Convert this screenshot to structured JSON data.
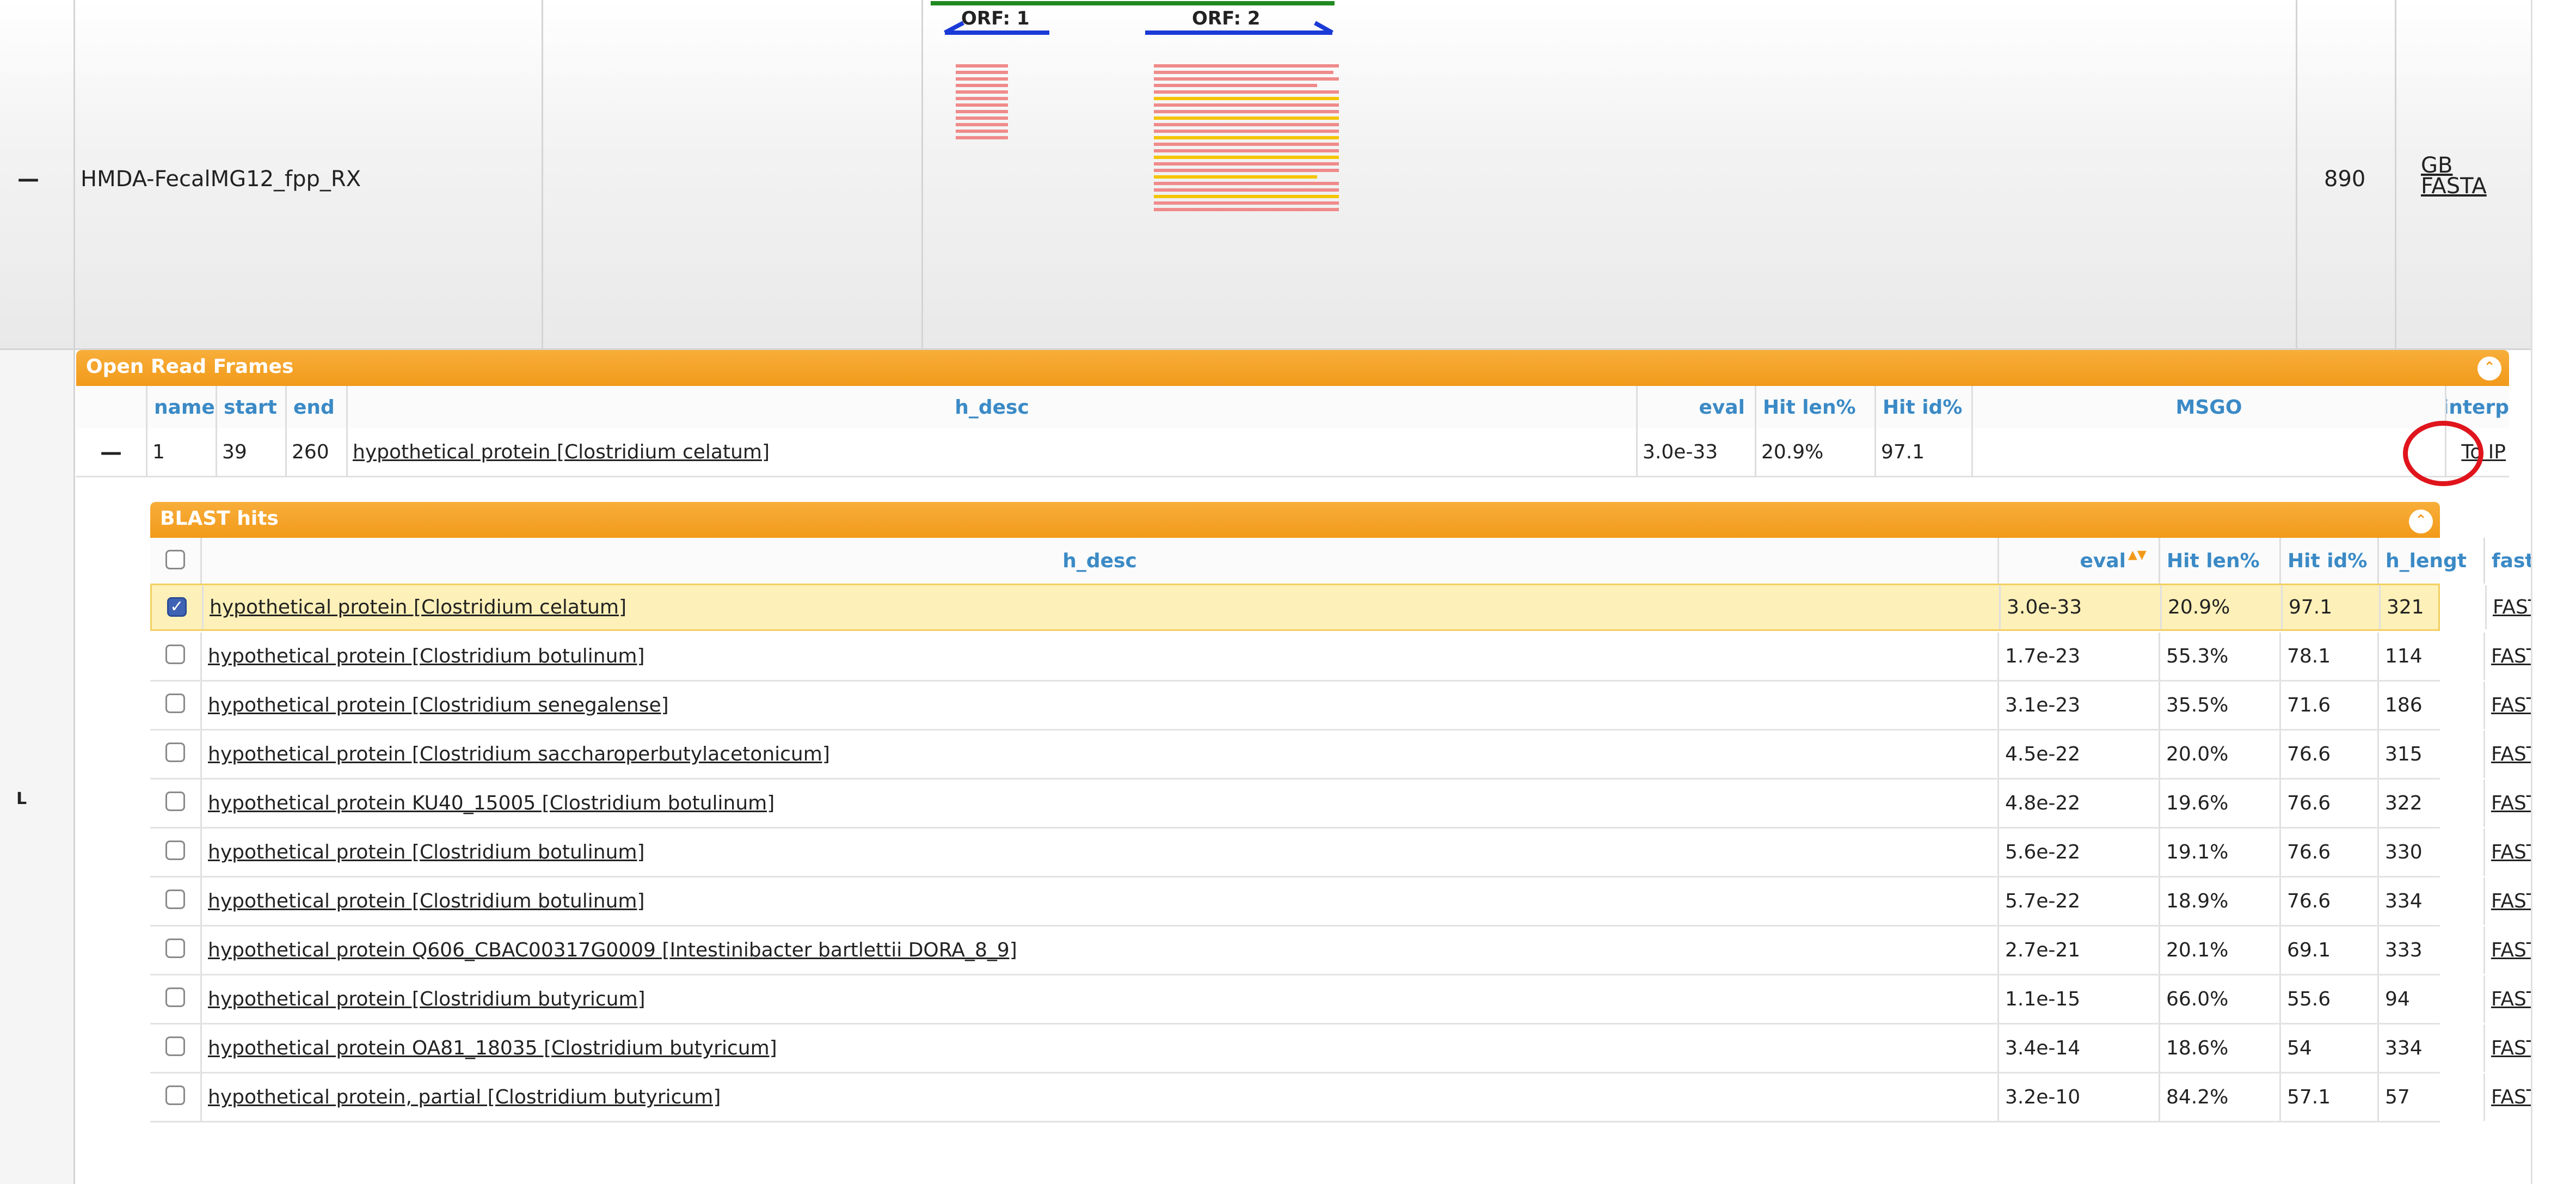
{
  "main_row": {
    "toggle": "—",
    "name": "HMDA-FecalMG12_fpp_RX",
    "length": "890",
    "links": [
      "GB",
      "FASTA"
    ]
  },
  "orf_track": {
    "labels": [
      "ORF: 1",
      "ORF: 2"
    ]
  },
  "left_markers": [
    "L",
    "L"
  ],
  "orf_panel": {
    "title": "Open Read Frames",
    "columns": [
      "name",
      "start",
      "end",
      "h_desc",
      "eval",
      "Hit len%",
      "Hit id%",
      "MSGO",
      "interp"
    ],
    "row": {
      "toggle": "—",
      "name": "1",
      "start": "39",
      "end": "260",
      "h_desc": "hypothetical protein [Clostridium celatum]",
      "eval": "3.0e-33",
      "hit_len": "20.9%",
      "hit_id": "97.1",
      "msgo": "",
      "interp": "To IP"
    }
  },
  "blast_panel": {
    "title": "BLAST hits",
    "columns": [
      "h_desc",
      "eval",
      "Hit len%",
      "Hit id%",
      "h_lengt",
      "fastalin"
    ],
    "sort_indicator": "▲▼",
    "rows": [
      {
        "checked": true,
        "h_desc": "hypothetical protein [Clostridium celatum]",
        "eval": "3.0e-33",
        "hit_len": "20.9%",
        "hit_id": "97.1",
        "h_length": "321",
        "fasta": "FASTA"
      },
      {
        "checked": false,
        "h_desc": "hypothetical protein [Clostridium botulinum]",
        "eval": "1.7e-23",
        "hit_len": "55.3%",
        "hit_id": "78.1",
        "h_length": "114",
        "fasta": "FASTA"
      },
      {
        "checked": false,
        "h_desc": "hypothetical protein [Clostridium senegalense]",
        "eval": "3.1e-23",
        "hit_len": "35.5%",
        "hit_id": "71.6",
        "h_length": "186",
        "fasta": "FASTA"
      },
      {
        "checked": false,
        "h_desc": "hypothetical protein [Clostridium saccharoperbutylacetonicum]",
        "eval": "4.5e-22",
        "hit_len": "20.0%",
        "hit_id": "76.6",
        "h_length": "315",
        "fasta": "FASTA"
      },
      {
        "checked": false,
        "h_desc": "hypothetical protein KU40_15005 [Clostridium botulinum]",
        "eval": "4.8e-22",
        "hit_len": "19.6%",
        "hit_id": "76.6",
        "h_length": "322",
        "fasta": "FASTA"
      },
      {
        "checked": false,
        "h_desc": "hypothetical protein [Clostridium botulinum]",
        "eval": "5.6e-22",
        "hit_len": "19.1%",
        "hit_id": "76.6",
        "h_length": "330",
        "fasta": "FASTA"
      },
      {
        "checked": false,
        "h_desc": "hypothetical protein [Clostridium botulinum]",
        "eval": "5.7e-22",
        "hit_len": "18.9%",
        "hit_id": "76.6",
        "h_length": "334",
        "fasta": "FASTA"
      },
      {
        "checked": false,
        "h_desc": "hypothetical protein Q606_CBAC00317G0009 [Intestinibacter bartlettii DORA_8_9]",
        "eval": "2.7e-21",
        "hit_len": "20.1%",
        "hit_id": "69.1",
        "h_length": "333",
        "fasta": "FASTA"
      },
      {
        "checked": false,
        "h_desc": "hypothetical protein [Clostridium butyricum]",
        "eval": "1.1e-15",
        "hit_len": "66.0%",
        "hit_id": "55.6",
        "h_length": "94",
        "fasta": "FASTA"
      },
      {
        "checked": false,
        "h_desc": "hypothetical protein OA81_18035 [Clostridium butyricum]",
        "eval": "3.4e-14",
        "hit_len": "18.6%",
        "hit_id": "54",
        "h_length": "334",
        "fasta": "FASTA"
      },
      {
        "checked": false,
        "h_desc": "hypothetical protein, partial [Clostridium butyricum]",
        "eval": "3.2e-10",
        "hit_len": "84.2%",
        "hit_id": "57.1",
        "h_length": "57",
        "fasta": "FASTA"
      }
    ]
  },
  "colors": {
    "accent": "#f19a1a",
    "header_text": "#3b8ac6",
    "selected_row": "#fdf0b8",
    "highlight_circle": "#e0141c",
    "orf_arrow": "#1a3ad6",
    "contig_line": "#1f8a1f",
    "hit_bar_pink": "#f08a8a",
    "hit_bar_yellow": "#f5c400"
  }
}
